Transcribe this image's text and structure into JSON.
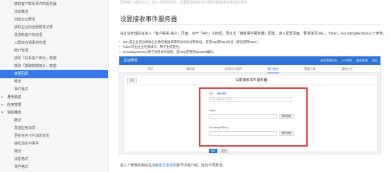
{
  "sidebar": {
    "items": [
      {
        "label": "获取客户联系事件的服务器",
        "level": 2
      },
      {
        "label": "消息推送",
        "level": 2
      },
      {
        "label": "创建企业群发",
        "level": 3
      },
      {
        "label": "获取企业的全部群发记录",
        "level": 3
      },
      {
        "label": "发送新客户欢迎语",
        "level": 3
      },
      {
        "label": "入群欢迎语素材管理",
        "level": 3
      },
      {
        "label": "统计管理",
        "level": 2
      },
      {
        "label": "获取「联系客户统计」数据",
        "level": 3
      },
      {
        "label": "获取「群聊数据统计」数据",
        "level": 3
      },
      {
        "label": "变更回调",
        "level": 2,
        "active": true
      },
      {
        "label": "概述",
        "level": 3
      },
      {
        "label": "事件格式",
        "level": 3
      },
      {
        "label": "身份验证",
        "level": 1,
        "chevron": true
      },
      {
        "label": "应用管理",
        "level": 1,
        "chevron": true
      },
      {
        "label": "消息推送",
        "level": 1,
        "chevron": true,
        "open": true
      },
      {
        "label": "概述",
        "level": 3
      },
      {
        "label": "发送应用消息",
        "level": 3
      },
      {
        "label": "更新任务卡片消息状态",
        "level": 3
      },
      {
        "label": "接收消息与事件",
        "level": 3
      },
      {
        "label": "概述",
        "level": 3
      },
      {
        "label": "消息格式",
        "level": 3
      },
      {
        "label": "事件格式",
        "level": 3
      }
    ]
  },
  "main": {
    "cut_text": "调用接口通知企业，客户发起联系时，需要配置接收事件服务器来接收推送的事件。",
    "heading": "设置接收事件服务器",
    "paragraph": "在企业管理后台进入「客户联系-客户」页面，点开「API」小按钮，再点击「接收事件服务器」配置，进入配置页面，要求填写URL，Token，EncodingAESKey三个参数。",
    "bullets": [
      "URL是企业后台接收企业微信推送请求的访问协议和地址，支持http或https协议（建议使用https）。",
      "Token可由企业任意填写，用于生成签名。",
      "EncodingAESKey用于消息体的加密，是AES密钥的Base64编码。"
    ],
    "footer": {
      "prefix": "这三个参数的用处在",
      "link": "加解密方案说明",
      "suffix": "章节中有介绍，此处不再赘述。"
    }
  },
  "screenshot": {
    "brand": "企业微信",
    "top_links": [
      "返回管理后台",
      "API文档",
      "联系客服",
      "退出"
    ],
    "nav": [
      "首页",
      "通讯录",
      "应用与小程序",
      "客户联系",
      "管理工具",
      "我的企业"
    ],
    "nav_active": 3,
    "back_label": "返回",
    "panel_title": "设置接收事件服务器",
    "fields": {
      "url_label": "URL",
      "url_link": "获取帮助",
      "url_placeholder": "http://或https://开头",
      "token_label": "Token",
      "token_button": "随机获取",
      "aes_label": "EncodingAESKey",
      "aes_button": "随机获取"
    },
    "save_label": "保存",
    "cancel_label": "取消",
    "accent": "#2d72d6",
    "highlight": "#e03b3b"
  }
}
